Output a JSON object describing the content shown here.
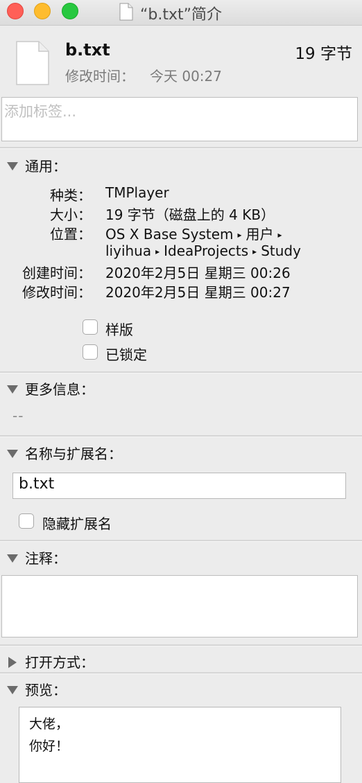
{
  "window": {
    "title": "“b.txt”简介"
  },
  "header": {
    "file_name": "b.txt",
    "file_size": "19 字节",
    "modified_label": "修改时间：",
    "modified_value": "今天 00:27"
  },
  "tags": {
    "placeholder": "添加标签..."
  },
  "general": {
    "heading": "通用：",
    "rows": [
      {
        "label": "种类：",
        "value": "TMPlayer"
      },
      {
        "label": "大小：",
        "value": "19 字节（磁盘上的 4 KB）"
      },
      {
        "label": "位置：",
        "path": [
          "OS X Base System",
          "用户",
          "liyihua",
          "IdeaProjects",
          "Study"
        ]
      },
      {
        "label": "创建时间：",
        "value": "2020年2月5日 星期三 00:26"
      },
      {
        "label": "修改时间：",
        "value": "2020年2月5日 星期三 00:27"
      }
    ],
    "arrow": "▸",
    "stationery_label": "样版",
    "locked_label": "已锁定"
  },
  "more_info": {
    "heading": "更多信息：",
    "value": "--"
  },
  "name_ext": {
    "heading": "名称与扩展名：",
    "value": "b.txt",
    "hide_ext_label": "隐藏扩展名"
  },
  "comments": {
    "heading": "注释："
  },
  "open_with": {
    "heading": "打开方式："
  },
  "preview": {
    "heading": "预览：",
    "lines": [
      "大佬，",
      "你好！"
    ]
  },
  "colors": {
    "close": "#ff5f57",
    "minimize": "#febc2e",
    "maximize": "#28c840",
    "background": "#ececec"
  }
}
